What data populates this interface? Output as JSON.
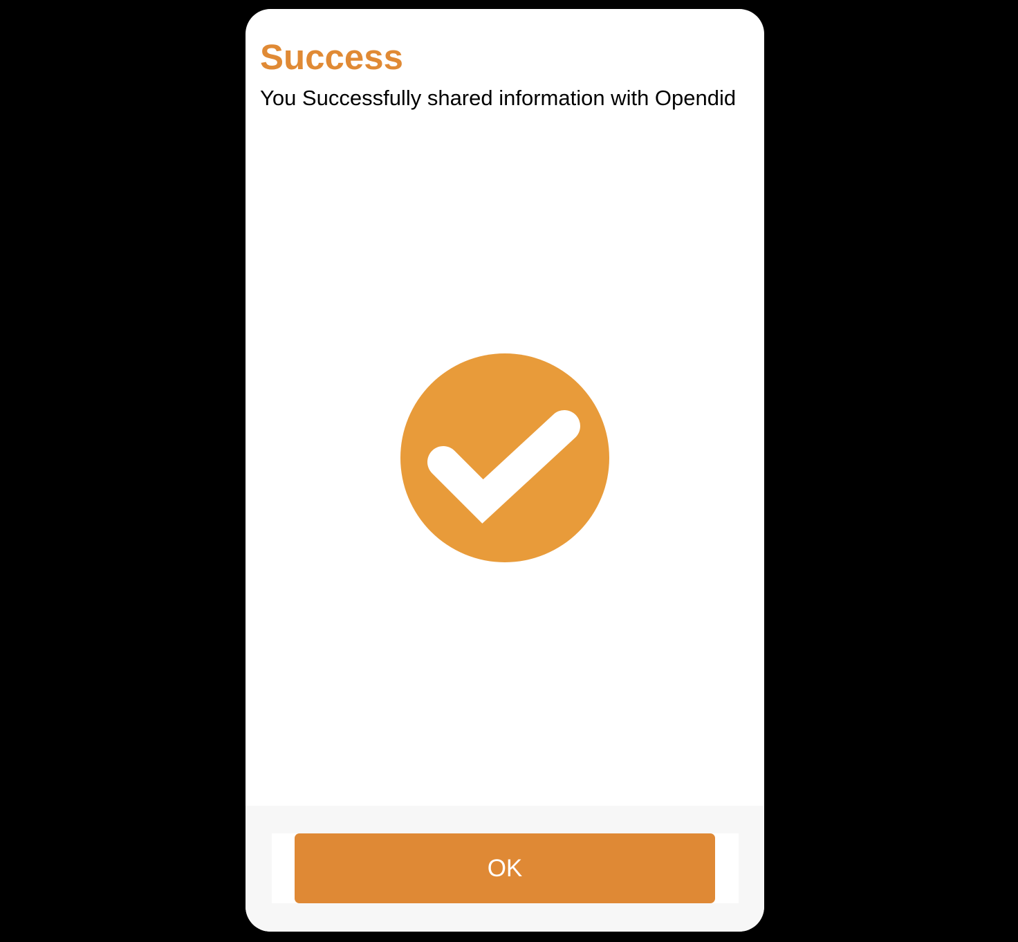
{
  "dialog": {
    "title": "Success",
    "message": "You Successfully shared information with Opendid",
    "icon": "check-circle-icon",
    "ok_label": "OK"
  },
  "colors": {
    "backdrop": "#000000",
    "dialog_background": "#ffffff",
    "title": "#e08a35",
    "icon_circle": "#e89b3a",
    "icon_check": "#ffffff",
    "footer_background": "#f7f7f7",
    "button_background": "#df8935",
    "button_text": "#ffffff"
  }
}
